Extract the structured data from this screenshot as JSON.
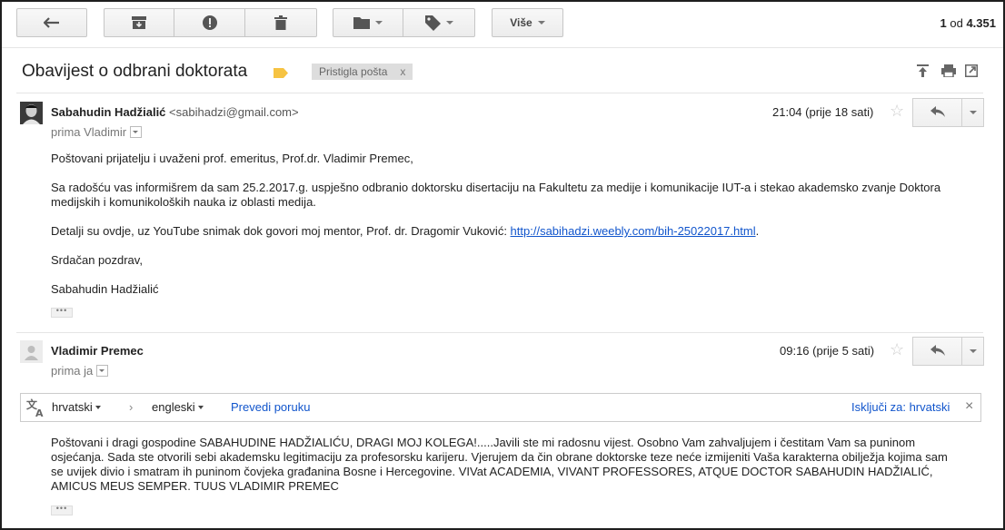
{
  "toolbar": {
    "reply_icon": "back-arrow-icon",
    "archive_icon": "archive-icon",
    "spam_icon": "report-spam-icon",
    "delete_icon": "trash-icon",
    "move_icon": "folder-icon",
    "labels_icon": "tag-icon",
    "more_label": "Više"
  },
  "pager": {
    "current": "1",
    "of": "od",
    "total": "4.351"
  },
  "subject": {
    "title": "Obavijest o odbrani doktorata",
    "label_color": "#f6c342",
    "chip_label": "Pristigla pošta",
    "chip_close": "x"
  },
  "messages": [
    {
      "sender_name": "Sabahudin Hadžialić",
      "sender_email": "<sabihadzi@gmail.com>",
      "to_line": "prima Vladimir",
      "time": "21:04 (prije 18 sati)",
      "greeting": "Poštovani prijatelju i uvaženi prof. emeritus, Prof.dr. Vladimir Premec,",
      "paragraph1": "Sa radošću vas informišrem da sam 25.2.2017.g. uspješno odbranio doktorsku disertaciju na Fakultetu za medije i komunikacije IUT-a i stekao akademsko zvanje Doktora medijskih i komunikoloških nauka iz oblasti medija.",
      "paragraph2_text": "Detalji su ovdje, uz YouTube snimak dok govori moj mentor, Prof. dr. Dragomir Vuković: ",
      "paragraph2_link": "http://sabihadzi.weebly.com/bih-25022017.html",
      "paragraph2_end": ".",
      "closing": "Srdačan pozdrav,",
      "signature": "Sabahudin Hadžialić",
      "ellipsis": "•••"
    },
    {
      "sender_name": "Vladimir Premec",
      "to_line": "prima ja",
      "time": "09:16 (prije 5 sati)",
      "body": "Poštovani i dragi gospodine SABAHUDINE HADŽIALIĆU, DRAGI MOJ KOLEGA!.....Javili ste mi radosnu vijest. Osobno Vam zahvaljujem i čestitam Vam sa puninom osjećanja. Sada ste otvorili sebi akademsku legitimaciju za profesorsku karijeru. Vjerujem da čin obrane doktorske teze neće izmijeniti Vaša karakterna obilježja kojima sam se uvijek divio i smatram ih puninom čovjeka građanina Bosne i Hercegovine. VIVat ACADEMIA, VIVANT PROFESSORES, ATQUE DOCTOR SABAHUDIN HADŽIALIĆ, AMICUS MEUS SEMPER. TUUS VLADIMIR PREMEC",
      "ellipsis": "•••"
    }
  ],
  "translate": {
    "source_lang": "hrvatski",
    "arrow": "›",
    "target_lang": "engleski",
    "action": "Prevedi poruku",
    "turn_off": "Isključi za: hrvatski",
    "close": "×"
  }
}
